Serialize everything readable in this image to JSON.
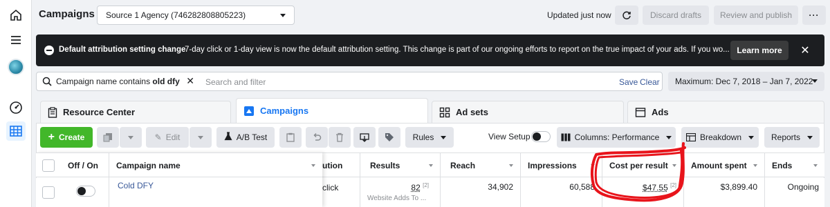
{
  "header": {
    "title": "Campaigns",
    "account": "Source 1 Agency (746282808805223)",
    "updated": "Updated just now",
    "discard": "Discard drafts",
    "review": "Review and publish",
    "more": "···"
  },
  "banner": {
    "title": "Default attribution setting change",
    "text": "7-day click or 1-day view is now the default attribution setting. This change is part of our ongoing efforts to report on the true impact of your ads. If you wo...",
    "learn_more": "Learn more",
    "close": "✕"
  },
  "filter": {
    "chip_prefix": "Campaign name contains ",
    "chip_value": "old dfy",
    "chip_close": "✕",
    "placeholder": "Search and filter",
    "save": "Save",
    "clear": "Clear",
    "date_range": "Maximum: Dec 7, 2018 – Jan 7, 2022"
  },
  "tabs": [
    {
      "label": "Resource Center",
      "icon": "clipboard-icon"
    },
    {
      "label": "Campaigns",
      "icon": "campaign-flag-icon"
    },
    {
      "label": "Ad sets",
      "icon": "grid-icon"
    },
    {
      "label": "Ads",
      "icon": "ad-window-icon"
    }
  ],
  "toolbar": {
    "create": "Create",
    "edit": "Edit",
    "ab_test": "A/B Test",
    "rules": "Rules",
    "view_setup": "View Setup",
    "columns": "Columns: Performance",
    "breakdown": "Breakdown",
    "reports": "Reports"
  },
  "table": {
    "headers": {
      "off_on": "Off / On",
      "campaign_name": "Campaign name",
      "attribution": "ution",
      "results": "Results",
      "reach": "Reach",
      "impressions": "Impressions",
      "cost_per_result": "Cost per result",
      "amount_spent": "Amount spent",
      "ends": "Ends"
    },
    "rows": [
      {
        "name": "Cold DFY",
        "attribution": "click",
        "results": "82",
        "results_note": "[2]",
        "results_sub": "Website Adds To ...",
        "reach": "34,902",
        "impressions": "60,588",
        "cost_per_result": "$47.55",
        "cost_note": "[2]",
        "amount_spent": "$3,899.40",
        "ends": "Ongoing"
      }
    ]
  },
  "colors": {
    "accent": "#1877f2",
    "create_green": "#42b72a",
    "banner_bg": "#1c1e21",
    "highlight_scribble": "#e8141b"
  }
}
